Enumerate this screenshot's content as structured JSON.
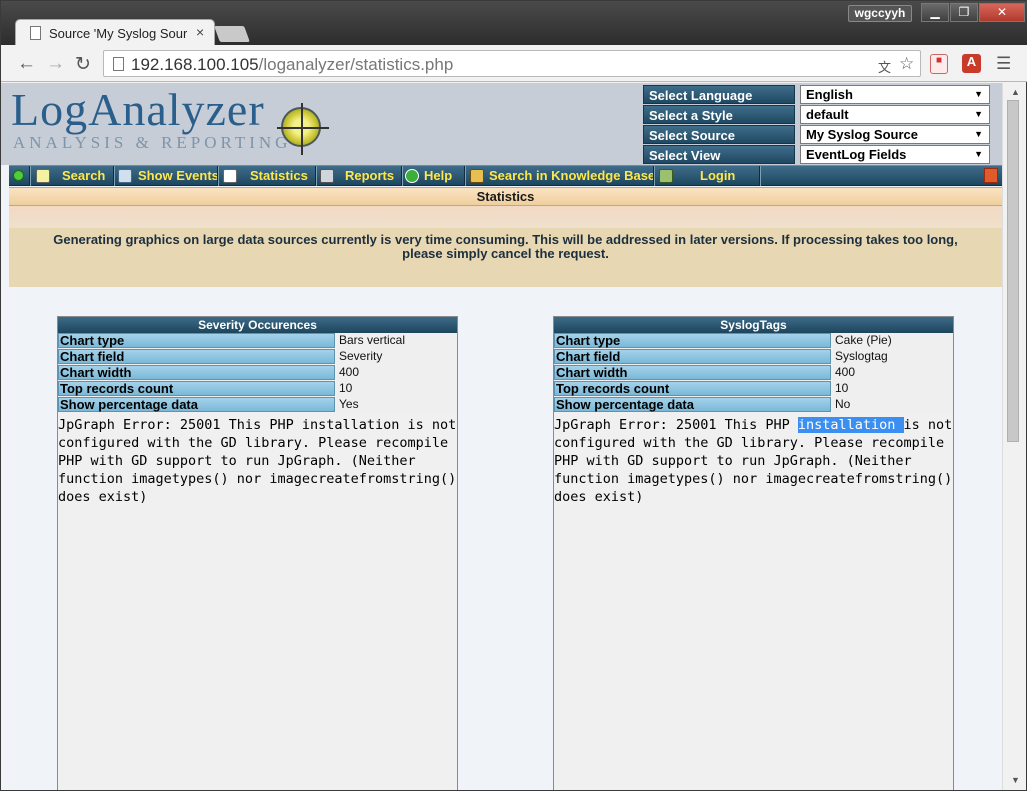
{
  "browser": {
    "tab_title": "Source 'My Syslog Source",
    "tab_close": "×",
    "user": "wgccyyh",
    "url_host": "192.168.100.105",
    "url_path": "/loganalyzer/statistics.php",
    "window_buttons": {
      "min": "▁",
      "max": "❐",
      "close": "✕"
    },
    "icons": {
      "back": "back-arrow-icon",
      "forward": "forward-arrow-icon",
      "reload": "reload-icon",
      "translate": "translate-icon",
      "star": "star-icon",
      "menu": "hamburger-menu-icon"
    }
  },
  "logo": {
    "title": "LogAnalyzer",
    "subtitle": "ANALYSIS & REPORTING"
  },
  "selectors": [
    {
      "label": "Select Language",
      "value": "English"
    },
    {
      "label": "Select a Style",
      "value": "default"
    },
    {
      "label": "Select Source",
      "value": "My Syslog Source"
    },
    {
      "label": "Select View",
      "value": "EventLog Fields"
    }
  ],
  "menu": {
    "search": "Search",
    "show_events": "Show Events",
    "statistics": "Statistics",
    "reports": "Reports",
    "help": "Help",
    "knowledge_base": "Search in Knowledge Base",
    "login": "Login"
  },
  "page": {
    "section_title": "Statistics",
    "notice": "Generating graphics on large data sources currently is very time consuming. This will be addressed in later versions. If processing takes too long, please simply cancel the request."
  },
  "panels": [
    {
      "title": "Severity Occurences",
      "rows": [
        {
          "key": "Chart type",
          "value": "Bars vertical"
        },
        {
          "key": "Chart field",
          "value": "Severity"
        },
        {
          "key": "Chart width",
          "value": "400"
        },
        {
          "key": "Top records count",
          "value": "10"
        },
        {
          "key": "Show percentage data",
          "value": "Yes"
        }
      ],
      "error_lines": [
        "JpGraph Error: 25001 This PHP installation is not",
        "configured with the GD library. Please recompile",
        "PHP with GD support to run JpGraph. (Neither",
        "function imagetypes() nor imagecreatefromstring()",
        "does exist)"
      ]
    },
    {
      "title": "SyslogTags",
      "rows": [
        {
          "key": "Chart type",
          "value": "Cake (Pie)"
        },
        {
          "key": "Chart field",
          "value": "Syslogtag"
        },
        {
          "key": "Chart width",
          "value": "400"
        },
        {
          "key": "Top records count",
          "value": "10"
        },
        {
          "key": "Show percentage data",
          "value": "No"
        }
      ],
      "error_line1_before": "JpGraph Error: 25001 This PHP ",
      "error_line1_highlight": "installation ",
      "error_line1_after": "is not",
      "error_lines_rest": [
        "configured with the GD library. Please recompile",
        "PHP with GD support to run JpGraph. (Neither",
        "function imagetypes() nor imagecreatefromstring()",
        "does exist)"
      ]
    }
  ]
}
